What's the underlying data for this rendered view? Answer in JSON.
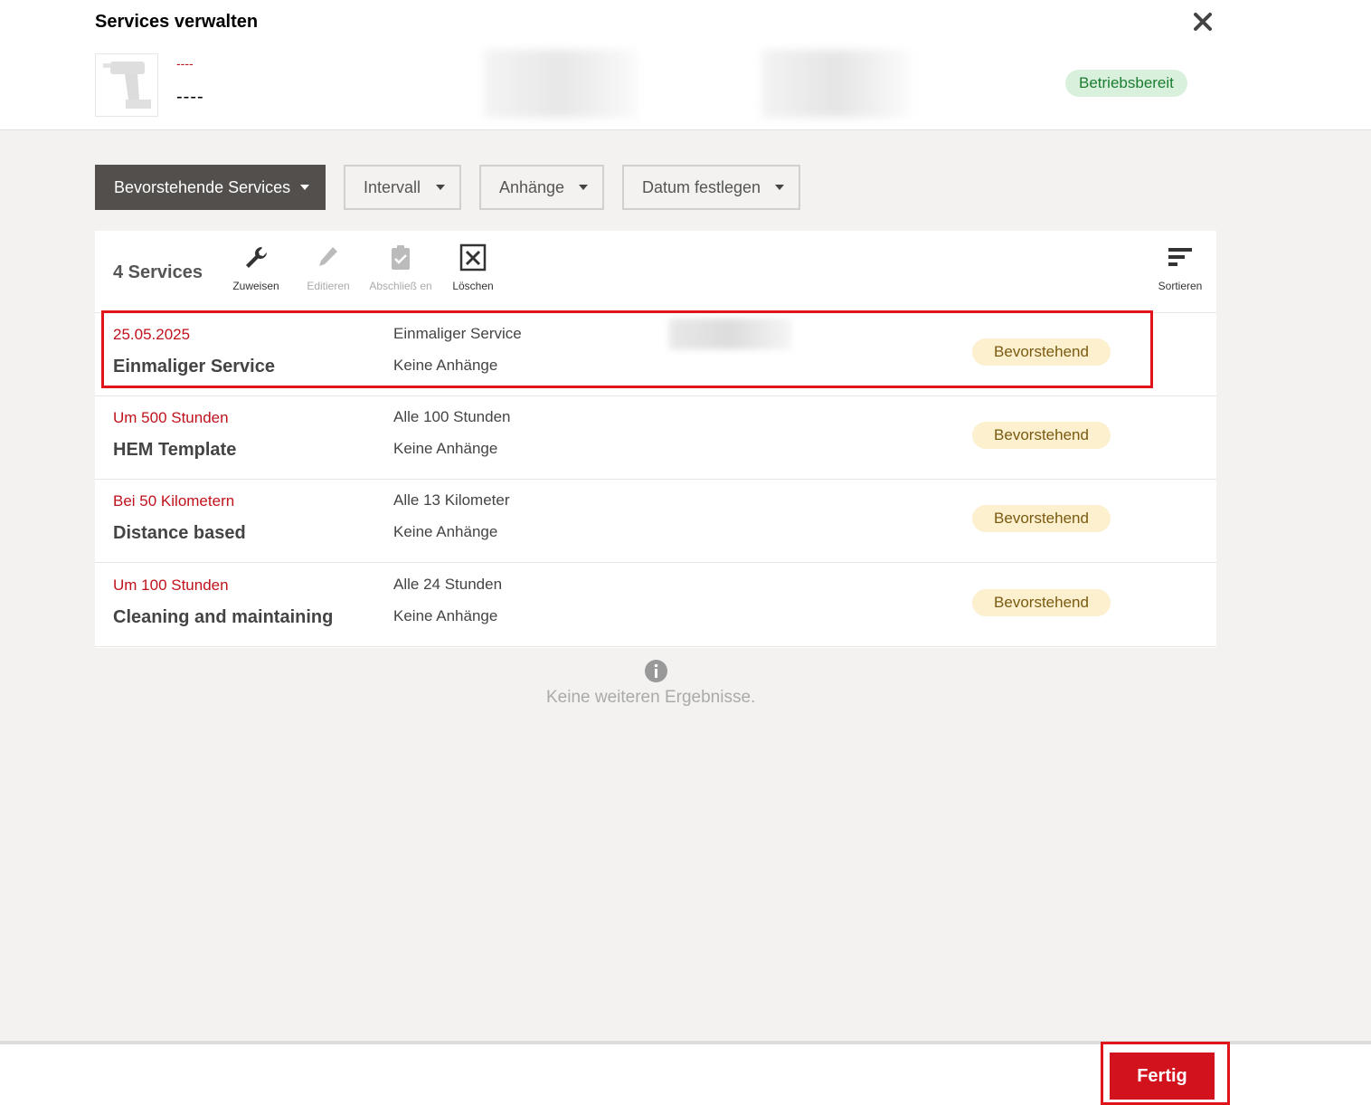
{
  "dialog": {
    "title": "Services verwalten",
    "close_icon": "close-icon"
  },
  "asset": {
    "image_icon": "drill-icon",
    "subtitle": "----",
    "name": "----",
    "status": "Betriebsbereit",
    "status_color": "#1c7d31"
  },
  "filters": [
    {
      "label": "Bevorstehende Services",
      "active": true
    },
    {
      "label": "Intervall"
    },
    {
      "label": "Anhänge"
    },
    {
      "label": "Datum festlegen"
    }
  ],
  "toolbar": {
    "count": "4 Services",
    "tools": [
      {
        "label": "Zuweisen",
        "icon": "wrench-icon",
        "enabled": true
      },
      {
        "label": "Editieren",
        "icon": "pencil-icon",
        "enabled": false
      },
      {
        "label": "Abschließ en",
        "icon": "clipboard-check-icon",
        "enabled": false
      },
      {
        "label": "Löschen",
        "icon": "delete-box-icon",
        "enabled": true
      },
      {
        "label": "Sortieren",
        "icon": "sort-icon",
        "enabled": true
      }
    ]
  },
  "services": [
    {
      "due": "25.05.2025",
      "name": "Einmaliger Service",
      "interval": "Einmaliger Service",
      "attachments": "Keine Anhänge",
      "status": "Bevorstehend",
      "highlighted": true
    },
    {
      "due": "Um 500 Stunden",
      "name": "HEM Template",
      "interval": "Alle 100 Stunden",
      "attachments": "Keine Anhänge",
      "status": "Bevorstehend"
    },
    {
      "due": "Bei 50 Kilometern",
      "name": "Distance based",
      "interval": "Alle 13 Kilometer",
      "attachments": "Keine Anhänge",
      "status": "Bevorstehend"
    },
    {
      "due": "Um 100 Stunden",
      "name": "Cleaning and maintaining",
      "interval": "Alle 24 Stunden",
      "attachments": "Keine Anhänge",
      "status": "Bevorstehend"
    }
  ],
  "empty_state": {
    "icon": "info-icon",
    "text": "Keine weiteren Ergebnisse."
  },
  "footer": {
    "done_label": "Fertig"
  },
  "colors": {
    "accent_red": "#d2121c",
    "due_red": "#c0121c",
    "badge_bg": "#fcf0cf",
    "dark_filter": "#534f4c"
  }
}
